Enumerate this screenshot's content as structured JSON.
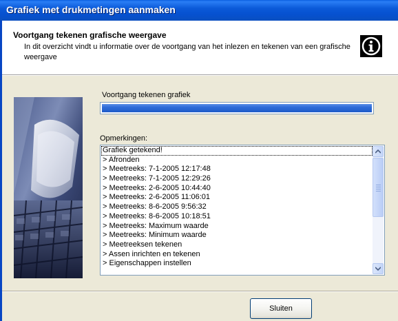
{
  "window": {
    "title": "Grafiek met drukmetingen aanmaken"
  },
  "header": {
    "title": "Voortgang tekenen grafische weergave",
    "description": "In dit overzicht vindt u informatie over de voortgang van het inlezen en tekenen van een grafische weergave",
    "icon": "info-icon"
  },
  "progress": {
    "label": "Voortgang tekenen grafiek",
    "value": 1.0,
    "color": "#2e6bd8"
  },
  "remarks": {
    "label": "Opmerkingen:",
    "items": [
      "Grafiek getekend!",
      "> Afronden",
      "> Meetreeks: 7-1-2005 12:17:48",
      "> Meetreeks: 7-1-2005 12:29:26",
      "> Meetreeks: 2-6-2005 10:44:40",
      "> Meetreeks: 2-6-2005 11:06:01",
      "> Meetreeks: 8-6-2005 9:56:32",
      "> Meetreeks: 8-6-2005 10:18:51",
      "> Meetreeks: Maximum waarde",
      "> Meetreeks: Minimum waarde",
      "> Meetreeksen tekenen",
      "> Assen inrichten en tekenen",
      "> Eigenschappen instellen"
    ]
  },
  "buttons": {
    "close_label": "Sluiten"
  },
  "colors": {
    "titlebar": "#0651d0",
    "dialog_bg": "#ece9d8"
  }
}
